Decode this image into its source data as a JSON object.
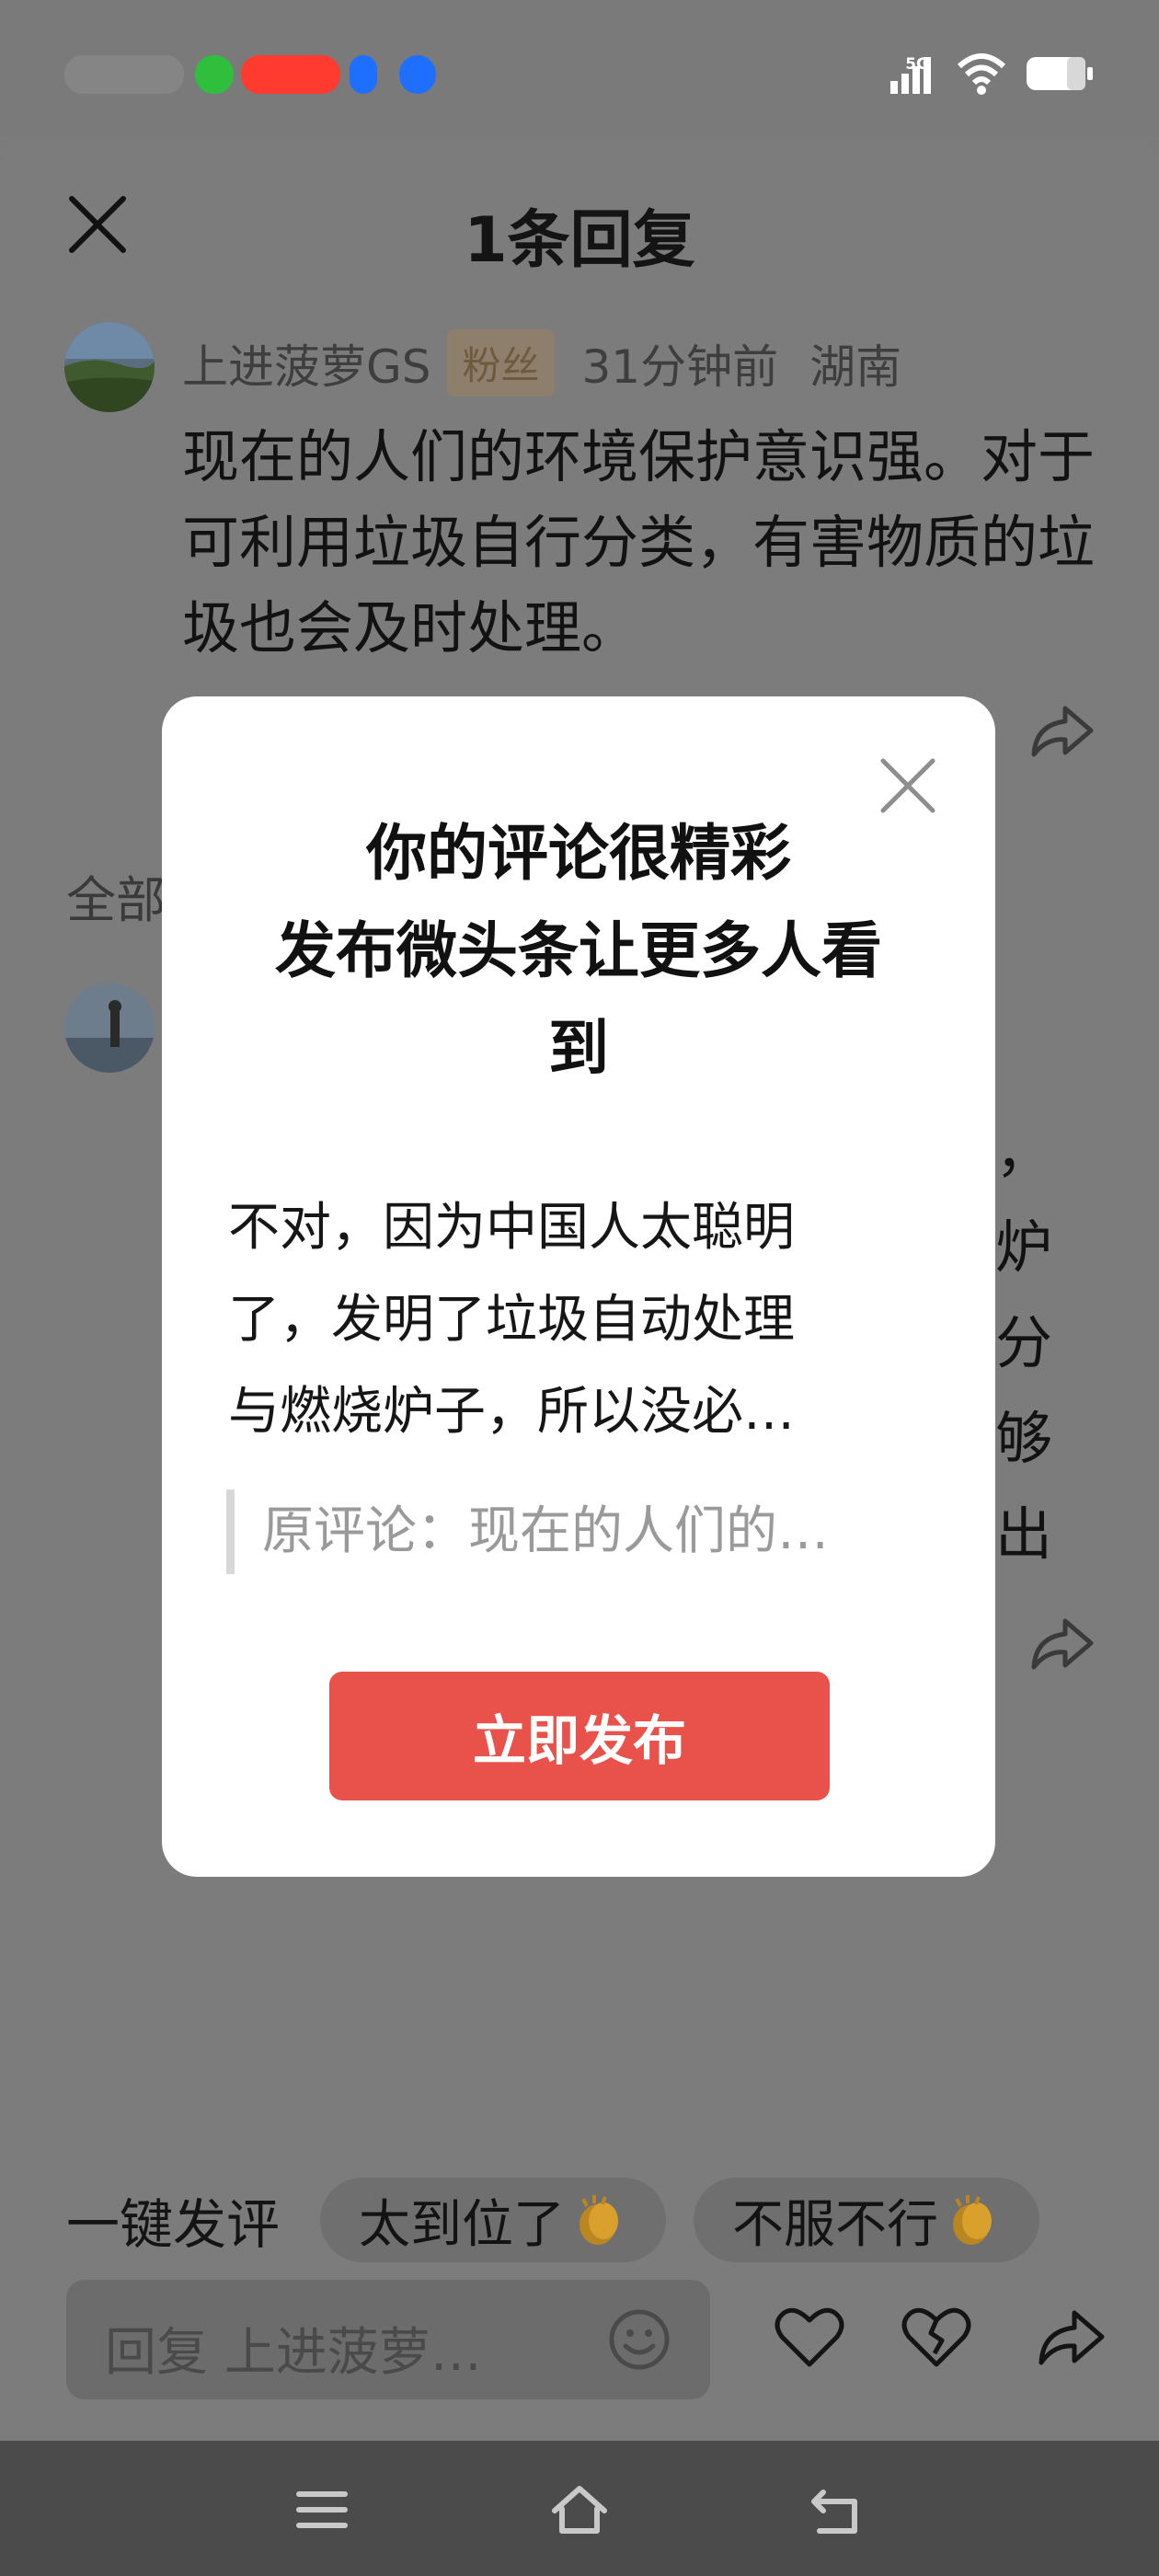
{
  "status_bar": {
    "network": "5G",
    "colors": {
      "redact_green": "#2fbf3d",
      "redact_red": "#ff3b2f",
      "redact_blue": "#1f6fff"
    }
  },
  "sheet": {
    "title": "1条回复",
    "close_icon": "close-icon"
  },
  "top_comment": {
    "author": "上进菠萝GS",
    "badge": "粉丝",
    "time": "31分钟前",
    "location": "湖南",
    "text": "现在的人们的环境保护意识强。对于可利用垃圾自行分类，有害物质的垃圾也会及时处理。"
  },
  "replies_section": {
    "label": "全部",
    "partial_chars": [
      "，",
      "炉",
      "分",
      "够",
      "出"
    ]
  },
  "dialog": {
    "title_line1": "你的评论很精彩",
    "title_line2": "发布微头条让更多人看",
    "title_line3": "到",
    "body_line1": "不对，因为中国人太聪明",
    "body_line2": "了，发明了垃圾自动处理",
    "body_line3": "与燃烧炉子，所以没必…",
    "quote": "原评论：现在的人们的…",
    "publish_label": "立即发布",
    "accent": "#e9524a"
  },
  "quick_replies": {
    "label": "一键发评",
    "chips": [
      "太到位了",
      "不服不行"
    ]
  },
  "reply_bar": {
    "placeholder": "回复 上进菠萝…",
    "icons": [
      "emoji-icon",
      "heart-icon",
      "broken-heart-icon",
      "share-icon"
    ]
  },
  "nav": {
    "icons": [
      "menu-icon",
      "home-icon",
      "back-icon"
    ]
  }
}
